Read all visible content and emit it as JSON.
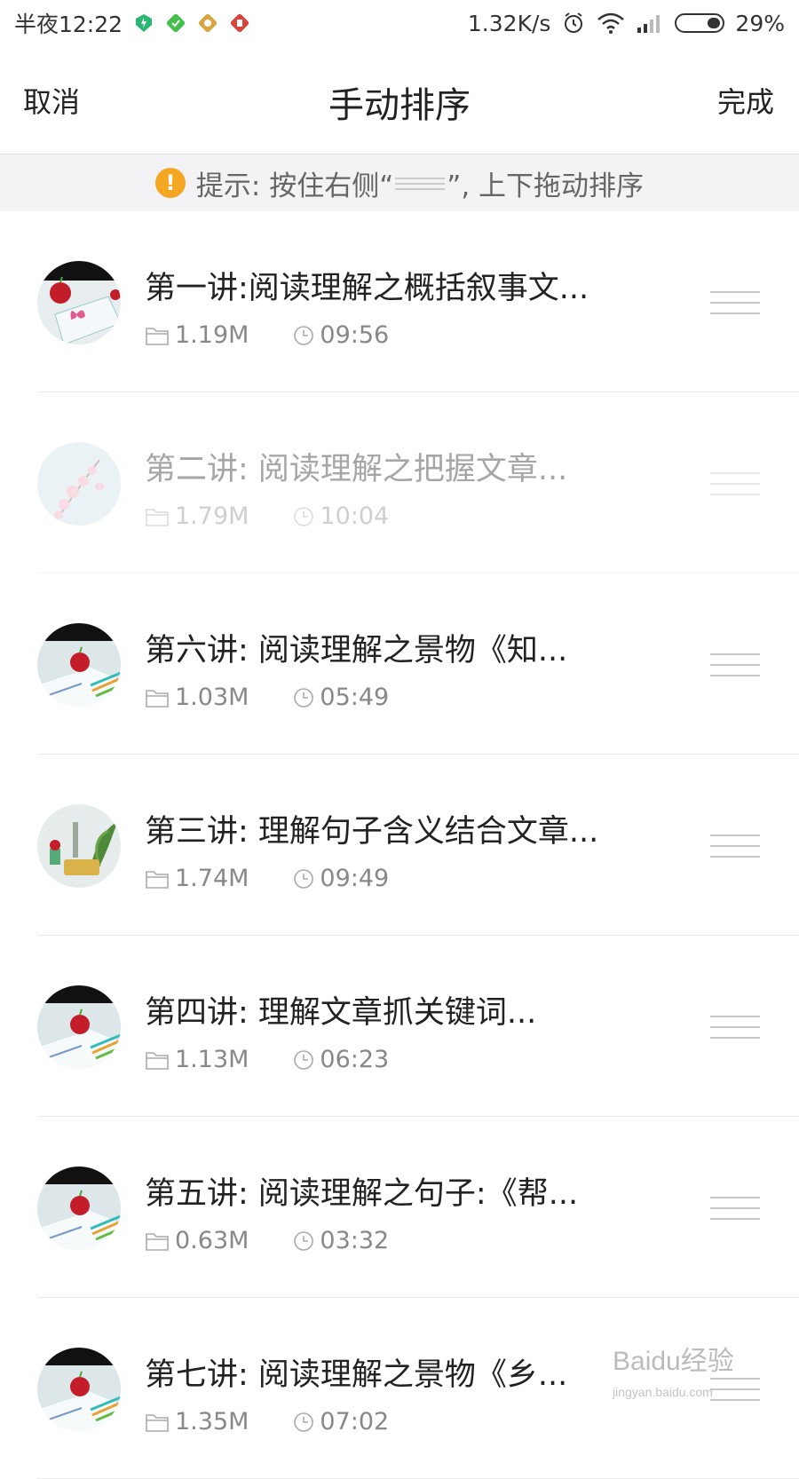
{
  "status_bar": {
    "time": "半夜12:22",
    "net_speed": "1.32K/s",
    "battery": "29%",
    "app_icons": [
      "green-shield-icon",
      "green-diamond-icon",
      "gold-diamond-icon",
      "red-app-icon"
    ]
  },
  "header": {
    "cancel_label": "取消",
    "title": "手动排序",
    "done_label": "完成"
  },
  "hint": {
    "prefix": "提示: 按住右侧“",
    "suffix": "”, 上下拖动排序",
    "icon": "!"
  },
  "items": [
    {
      "title": "第一讲:阅读理解之概括叙事文...",
      "size": "1.19M",
      "duration": "09:56",
      "thumb": "apple-butterfly",
      "state": "normal"
    },
    {
      "title": "第二讲: 阅读理解之把握文章...",
      "size": "1.79M",
      "duration": "10:04",
      "thumb": "flowers",
      "state": "dragging"
    },
    {
      "title": "第六讲: 阅读理解之景物《知...",
      "size": "1.03M",
      "duration": "05:49",
      "thumb": "apple-pencils",
      "state": "normal"
    },
    {
      "title": "第三讲: 理解句子含义结合文章...",
      "size": "1.74M",
      "duration": "09:49",
      "thumb": "plants",
      "state": "normal"
    },
    {
      "title": "第四讲: 理解文章抓关键词...",
      "size": "1.13M",
      "duration": "06:23",
      "thumb": "apple-pencils",
      "state": "normal"
    },
    {
      "title": "第五讲: 阅读理解之句子:《帮...",
      "size": "0.63M",
      "duration": "03:32",
      "thumb": "apple-pencils",
      "state": "normal"
    },
    {
      "title": "第七讲: 阅读理解之景物《乡...",
      "size": "1.35M",
      "duration": "07:02",
      "thumb": "apple-pencils",
      "state": "normal"
    }
  ],
  "watermark": {
    "brand": "Baidu经验",
    "url": "jingyan.baidu.com"
  }
}
